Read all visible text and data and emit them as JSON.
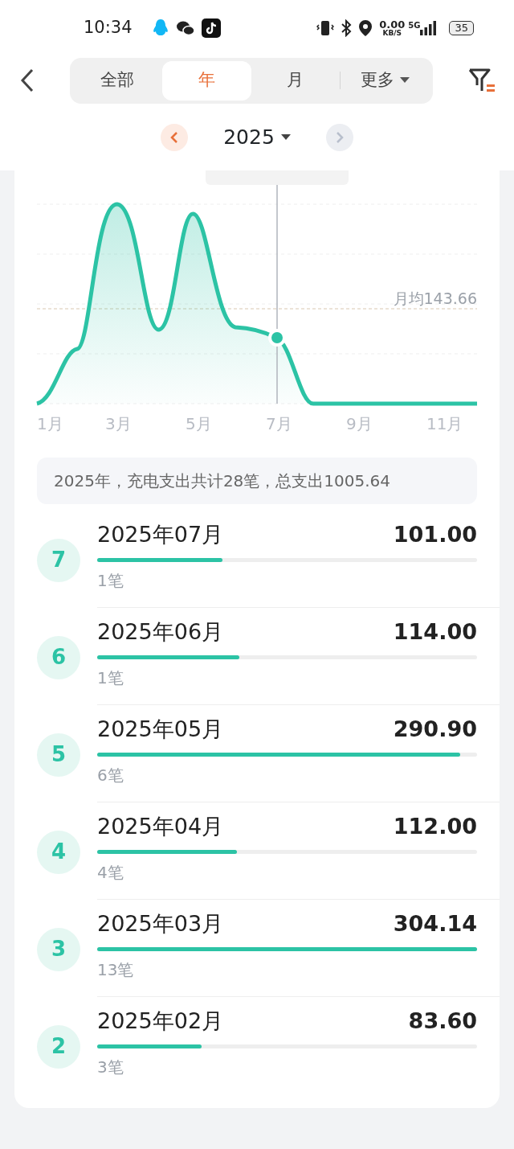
{
  "status_bar": {
    "time": "10:34",
    "net_speed": "0.00",
    "net_unit": "KB/S",
    "network": "5G",
    "battery": "35"
  },
  "tabs": [
    {
      "label": "全部",
      "selected": false
    },
    {
      "label": "年",
      "selected": true
    },
    {
      "label": "月",
      "selected": false
    },
    {
      "label": "更多",
      "selected": false,
      "kind": "dropdown"
    }
  ],
  "year_picker": {
    "year": "2025",
    "prev_disabled": false,
    "next_disabled": true
  },
  "chart": {
    "average_label": "月均143.66",
    "x_labels": [
      "1月",
      "3月",
      "5月",
      "7月",
      "9月",
      "11月"
    ]
  },
  "summary": "2025年，充电支出共计28笔，总支出1005.64",
  "months": [
    {
      "rank": "7",
      "month": "2025年07月",
      "amount": "101.00",
      "count": "1笔",
      "level": 0.33
    },
    {
      "rank": "6",
      "month": "2025年06月",
      "amount": "114.00",
      "count": "1笔",
      "level": 0.375
    },
    {
      "rank": "5",
      "month": "2025年05月",
      "amount": "290.90",
      "count": "6笔",
      "level": 0.956
    },
    {
      "rank": "4",
      "month": "2025年04月",
      "amount": "112.00",
      "count": "4笔",
      "level": 0.368
    },
    {
      "rank": "3",
      "month": "2025年03月",
      "amount": "304.14",
      "count": "13笔",
      "level": 1
    },
    {
      "rank": "2",
      "month": "2025年02月",
      "amount": "83.60",
      "count": "3笔",
      "level": 0.275
    }
  ]
}
